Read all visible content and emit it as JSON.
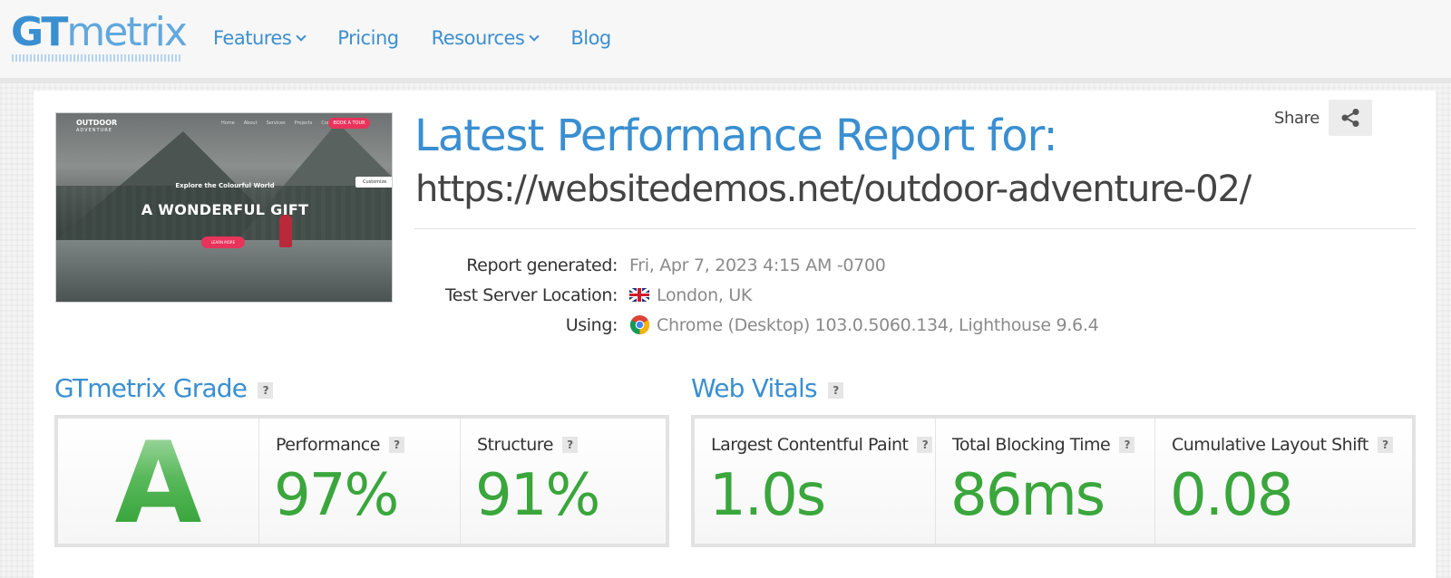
{
  "header": {
    "logo_bold": "GT",
    "logo_rest": "metrix",
    "nav": [
      {
        "label": "Features",
        "dropdown": true
      },
      {
        "label": "Pricing",
        "dropdown": false
      },
      {
        "label": "Resources",
        "dropdown": true
      },
      {
        "label": "Blog",
        "dropdown": false
      }
    ]
  },
  "report": {
    "title": "Latest Performance Report for:",
    "url": "https://websitedemos.net/outdoor-adventure-02/",
    "share_label": "Share",
    "meta": {
      "generated_label": "Report generated:",
      "generated_value": "Fri, Apr 7, 2023 4:15 AM -0700",
      "location_label": "Test Server Location:",
      "location_value": "London, UK",
      "using_label": "Using:",
      "using_value": "Chrome (Desktop) 103.0.5060.134, Lighthouse 9.6.4"
    },
    "screenshot": {
      "brand": "OUTDOOR",
      "brand_sub": "ADVENTURE",
      "menu": [
        "Home",
        "About",
        "Services",
        "Projects",
        "Contact"
      ],
      "book_button": "BOOK A TOUR",
      "subtitle": "Explore the Colourful World",
      "headline": "A WONDERFUL GIFT",
      "cta": "LEARN MORE",
      "chip": "Customize"
    }
  },
  "grade": {
    "title": "GTmetrix Grade",
    "letter": "A",
    "performance_label": "Performance",
    "performance_value": "97%",
    "structure_label": "Structure",
    "structure_value": "91%"
  },
  "vitals": {
    "title": "Web Vitals",
    "lcp_label": "Largest Contentful Paint",
    "lcp_value": "1.0s",
    "tbt_label": "Total Blocking Time",
    "tbt_value": "86ms",
    "cls_label": "Cumulative Layout Shift",
    "cls_value": "0.08"
  },
  "colors": {
    "brand_blue": "#3a8fd1",
    "grade_green": "#3aa63c"
  }
}
